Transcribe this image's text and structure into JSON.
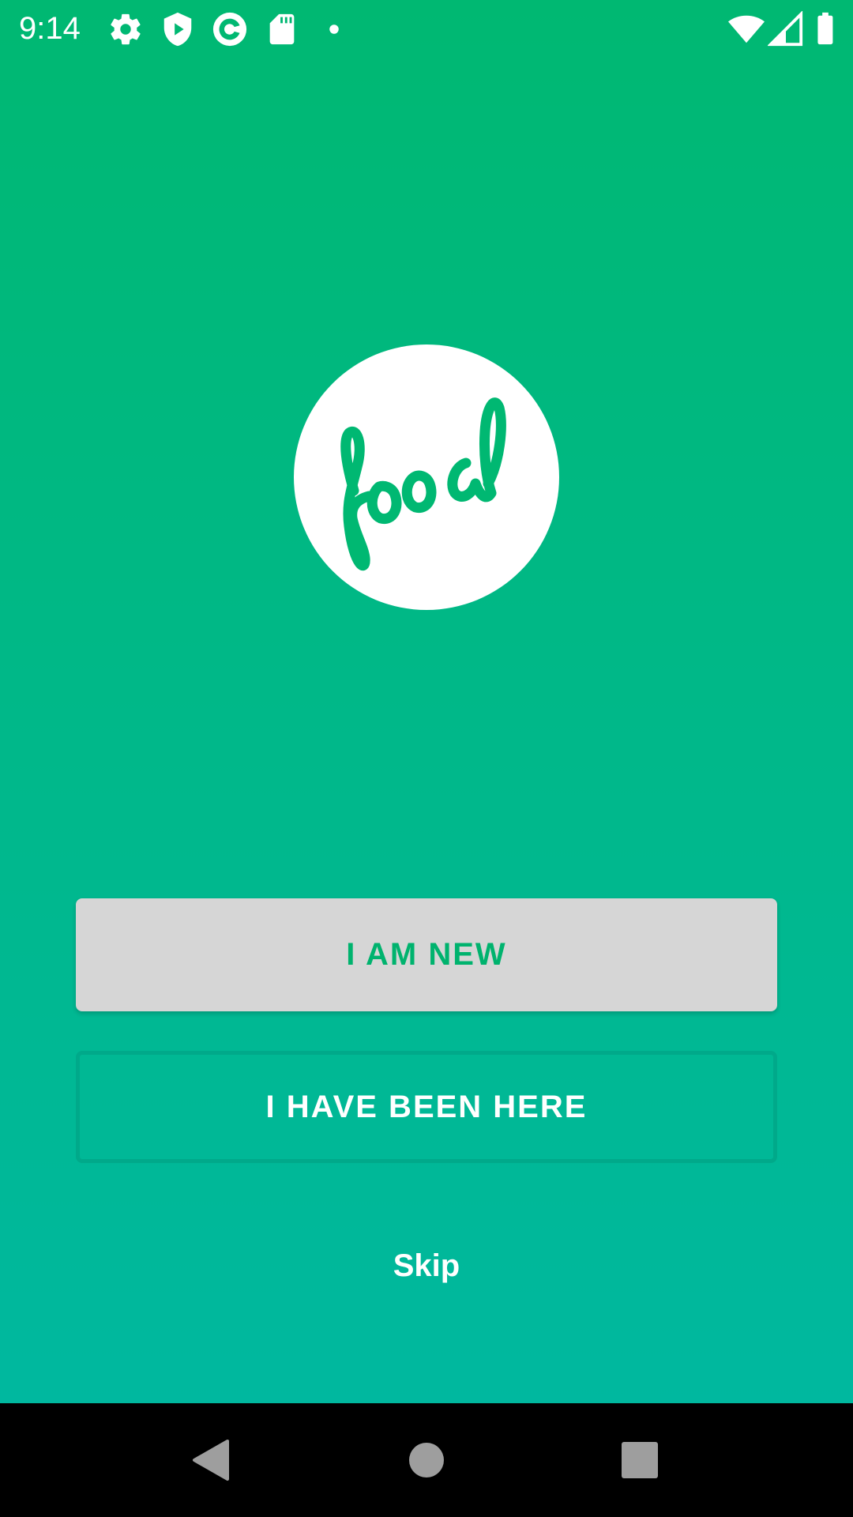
{
  "status_bar": {
    "time": "9:14",
    "icons": [
      "gear-icon",
      "shield-play-icon",
      "circle-app-icon",
      "sd-card-icon",
      "dot-icon",
      "wifi-icon",
      "signal-icon",
      "battery-icon"
    ]
  },
  "logo": {
    "text": "food",
    "circle_color": "#ffffff",
    "text_color": "#00b872"
  },
  "buttons": {
    "new_label": "I AM NEW",
    "been_label": "I HAVE BEEN HERE",
    "skip_label": "Skip"
  },
  "colors": {
    "gradient_top": "#00b872",
    "gradient_bottom": "#00b89f",
    "new_button_bg": "#d6d6d6",
    "new_button_text": "#00b36e",
    "been_button_border": "#00a98a"
  },
  "nav_bar": {
    "icons": [
      "back-icon",
      "home-icon",
      "recents-icon"
    ]
  }
}
